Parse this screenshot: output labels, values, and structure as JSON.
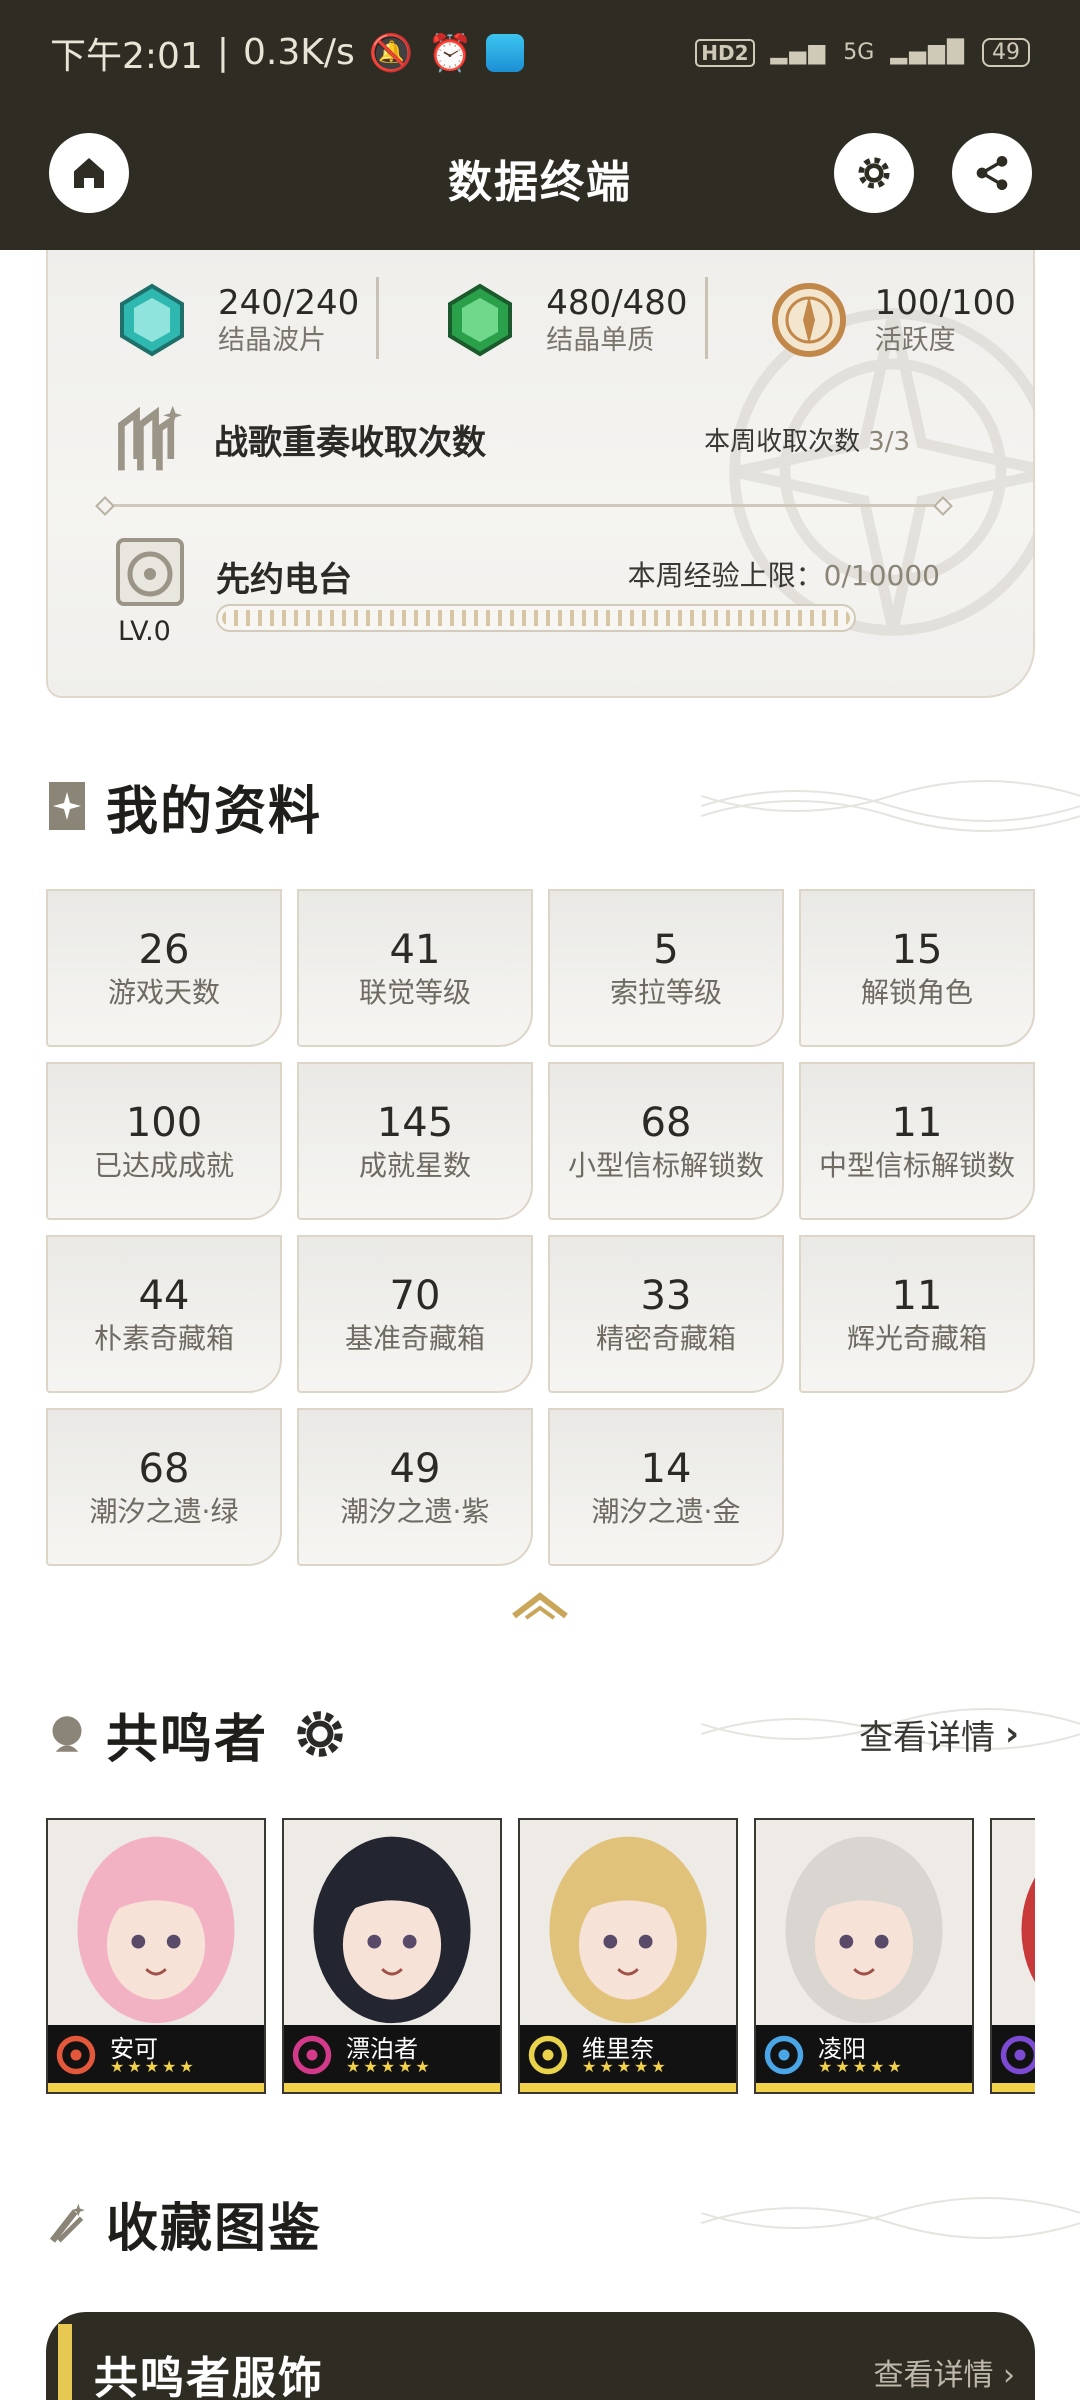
{
  "status_bar": {
    "time": "下午2:01",
    "network_speed": "0.3K/s",
    "hd_badge": "HD2",
    "net_type": "5G",
    "battery": "49"
  },
  "header": {
    "title": "数据终端",
    "home_icon": "home-icon",
    "settings_icon": "gear-icon",
    "share_icon": "share-icon"
  },
  "daily": {
    "resources": [
      {
        "value": "240/240",
        "label": "结晶波片",
        "icon": "crystal-wave-icon",
        "color": "#2fb8b0"
      },
      {
        "value": "480/480",
        "label": "结晶单质",
        "icon": "crystal-solute-icon",
        "color": "#2aa04a"
      },
      {
        "value": "100/100",
        "label": "活跃度",
        "icon": "compass-icon",
        "color": "#c2884a"
      }
    ],
    "song": {
      "title": "战歌重奏收取次数",
      "count_label": "本周收取次数",
      "count": "3/3"
    },
    "radio": {
      "title": "先约电台",
      "level": "LV.0",
      "exp_label": "本周经验上限：",
      "exp_value": "0/10000",
      "progress": 0.0
    }
  },
  "profile": {
    "title": "我的资料",
    "stats": [
      {
        "value": "26",
        "label": "游戏天数"
      },
      {
        "value": "41",
        "label": "联觉等级"
      },
      {
        "value": "5",
        "label": "索拉等级"
      },
      {
        "value": "15",
        "label": "解锁角色"
      },
      {
        "value": "100",
        "label": "已达成成就"
      },
      {
        "value": "145",
        "label": "成就星数"
      },
      {
        "value": "68",
        "label": "小型信标解锁数"
      },
      {
        "value": "11",
        "label": "中型信标解锁数"
      },
      {
        "value": "44",
        "label": "朴素奇藏箱"
      },
      {
        "value": "70",
        "label": "基准奇藏箱"
      },
      {
        "value": "33",
        "label": "精密奇藏箱"
      },
      {
        "value": "11",
        "label": "辉光奇藏箱"
      },
      {
        "value": "68",
        "label": "潮汐之遗·绿"
      },
      {
        "value": "49",
        "label": "潮汐之遗·紫"
      },
      {
        "value": "14",
        "label": "潮汐之遗·金"
      }
    ]
  },
  "resonators": {
    "title": "共鸣者",
    "more": "查看详情",
    "characters": [
      {
        "name": "安可",
        "stars": "★★★★★",
        "element": "fusion-icon",
        "hair": "#f3b2c4",
        "elem_color": "#e3583a"
      },
      {
        "name": "漂泊者",
        "stars": "★★★★★",
        "element": "havoc-icon",
        "hair": "#232630",
        "elem_color": "#d43a8a"
      },
      {
        "name": "维里奈",
        "stars": "★★★★★",
        "element": "spectro-icon",
        "hair": "#e0c27a",
        "elem_color": "#e8d34a"
      },
      {
        "name": "凌阳",
        "stars": "★★★★★",
        "element": "glacio-icon",
        "hair": "#d9d6d2",
        "elem_color": "#4aa6e6"
      },
      {
        "name": "",
        "stars": "",
        "element": "havoc-icon",
        "hair": "#c83a3a",
        "elem_color": "#7d4ad4"
      }
    ]
  },
  "collection": {
    "title": "收藏图鉴",
    "outfit_title": "共鸣者服饰",
    "outfit_more": "查看详情"
  }
}
